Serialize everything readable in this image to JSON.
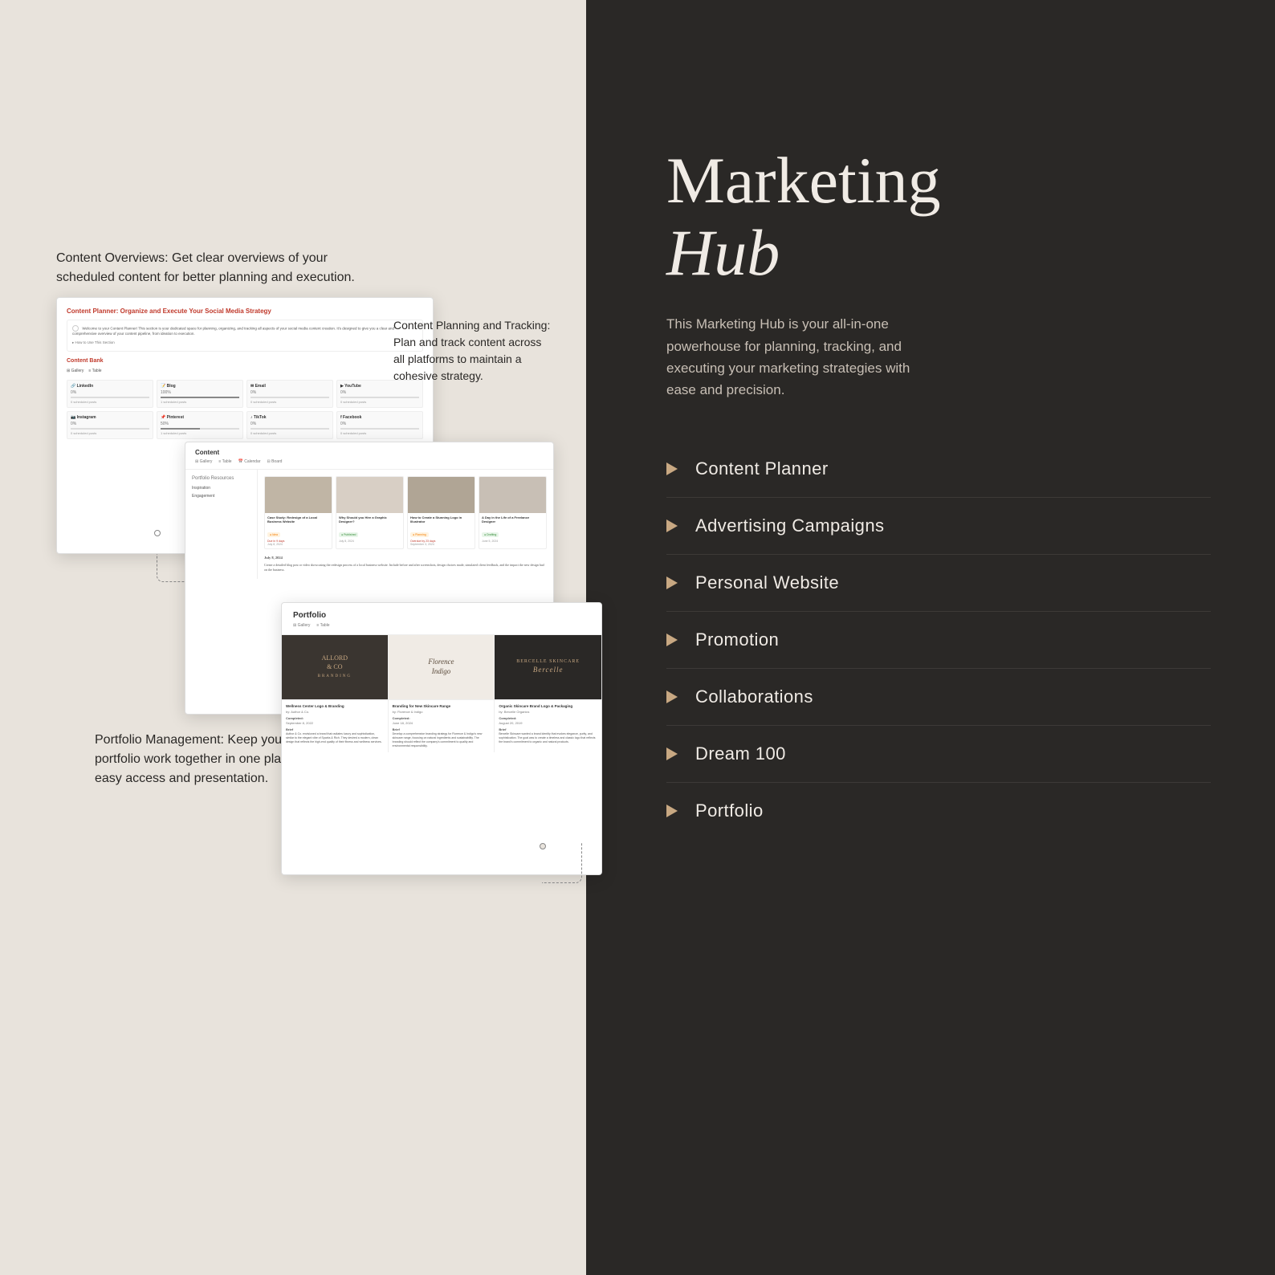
{
  "left": {
    "content_overview_text": "Content Overviews: Get clear overviews of your scheduled\ncontent for better planning and execution.",
    "portfolio_text": "Portfolio Management: Keep your\nportfolio work together in one place\nfor easy access and presentation.",
    "content_planning_text": "Content Planning and\nTracking: Plan and\ntrack content across all\nplatforms to maintain a\ncohesive strategy."
  },
  "right": {
    "title_normal": "Marketing",
    "title_italic": "Hub",
    "description": "This Marketing Hub is your all-in-one powerhouse for planning, tracking, and executing your marketing strategies with ease and precision.",
    "nav_items": [
      {
        "label": "Content Planner",
        "id": "content-planner"
      },
      {
        "label": "Advertising Campaigns",
        "id": "advertising-campaigns"
      },
      {
        "label": "Personal Website",
        "id": "personal-website"
      },
      {
        "label": "Promotion",
        "id": "promotion"
      },
      {
        "label": "Collaborations",
        "id": "collaborations"
      },
      {
        "label": "Dream 100",
        "id": "dream-100"
      },
      {
        "label": "Portfolio",
        "id": "portfolio"
      }
    ]
  },
  "screenshot_planner": {
    "title": "Content Planner: Organize and Execute Your Social Media Strategy",
    "desc": "Welcome to your Content Planner! This section is your dedicated space for planning, organizing, and tracking all aspects of your social media content creation. It's designed to give you a clear and comprehensive overview of your content pipeline, from ideation to execution.",
    "section": "Content Bank",
    "tabs": [
      "Gallery",
      "Table"
    ],
    "platforms": [
      {
        "name": "LinkedIn",
        "pct": "0%",
        "posts": "0 scheduled posts"
      },
      {
        "name": "Blog",
        "pct": "100%",
        "posts": "1 scheduled posts"
      },
      {
        "name": "Email",
        "pct": "0%",
        "posts": "0 scheduled posts"
      },
      {
        "name": "YouTube",
        "pct": "0%",
        "posts": "0 scheduled posts"
      },
      {
        "name": "Instagram",
        "pct": "0%",
        "posts": "0 scheduled posts"
      },
      {
        "name": "Pinterest",
        "pct": "50%",
        "posts": "1 scheduled posts"
      },
      {
        "name": "TikTok",
        "pct": "0%",
        "posts": "0 scheduled posts"
      },
      {
        "name": "Facebook",
        "pct": "0%",
        "posts": "0 scheduled posts"
      }
    ]
  },
  "screenshot_gallery": {
    "title": "Content",
    "tabs": [
      "Gallery",
      "Table",
      "Calendar",
      "Board"
    ],
    "cards": [
      {
        "title": "Case Study: Redesign of a Local Business Website",
        "badge": "Idea",
        "badge_type": "orange",
        "date": "July 8, 2024"
      },
      {
        "title": "Why Should you Hire a Graphic Designer?",
        "badge": "Published",
        "badge_type": "green",
        "date": "July 8, 2024"
      },
      {
        "title": "How to Create a Stunning Logo in Illustrator",
        "badge": "Planning",
        "badge_type": "orange",
        "date": "September 3, 2024"
      },
      {
        "title": "A Day in the Life of a Freelance Designer",
        "badge": "Drafting",
        "badge_type": "green",
        "date": "June 5, 2024"
      }
    ],
    "sidebar_title": "Portfolio Resources",
    "sidebar_items": [
      "Inspiration",
      "Engagement"
    ]
  },
  "screenshot_portfolio": {
    "title": "Portfolio",
    "tabs": [
      "Gallery",
      "Table"
    ],
    "cards": [
      {
        "title": "Wellness Center Logo & Branding",
        "subtitle": "Author & Co.",
        "completed_label": "Completed:",
        "completed_date": "September 8, 2022",
        "brief_label": "Brief",
        "brief_text": "Author & Co. envisioned a brand that radiates luxury and sophistication..."
      },
      {
        "title": "Branding for New Skincare Range",
        "subtitle": "Florence & Indigo",
        "completed_label": "Completed:",
        "completed_date": "June 18, 2024",
        "brief_label": "Brief",
        "brief_text": "Develop a comprehensive branding strategy for Florence & Indigo's new skincare range..."
      },
      {
        "title": "Organic Skincare Brand Logo & Packaging",
        "subtitle": "Bercelle Organics",
        "completed_label": "Completed:",
        "completed_date": "August 20, 2019",
        "brief_label": "Brief",
        "brief_text": "Bercelle Skincare wanted a brand identity that evokes elegance, purity, and sophistication..."
      }
    ]
  }
}
